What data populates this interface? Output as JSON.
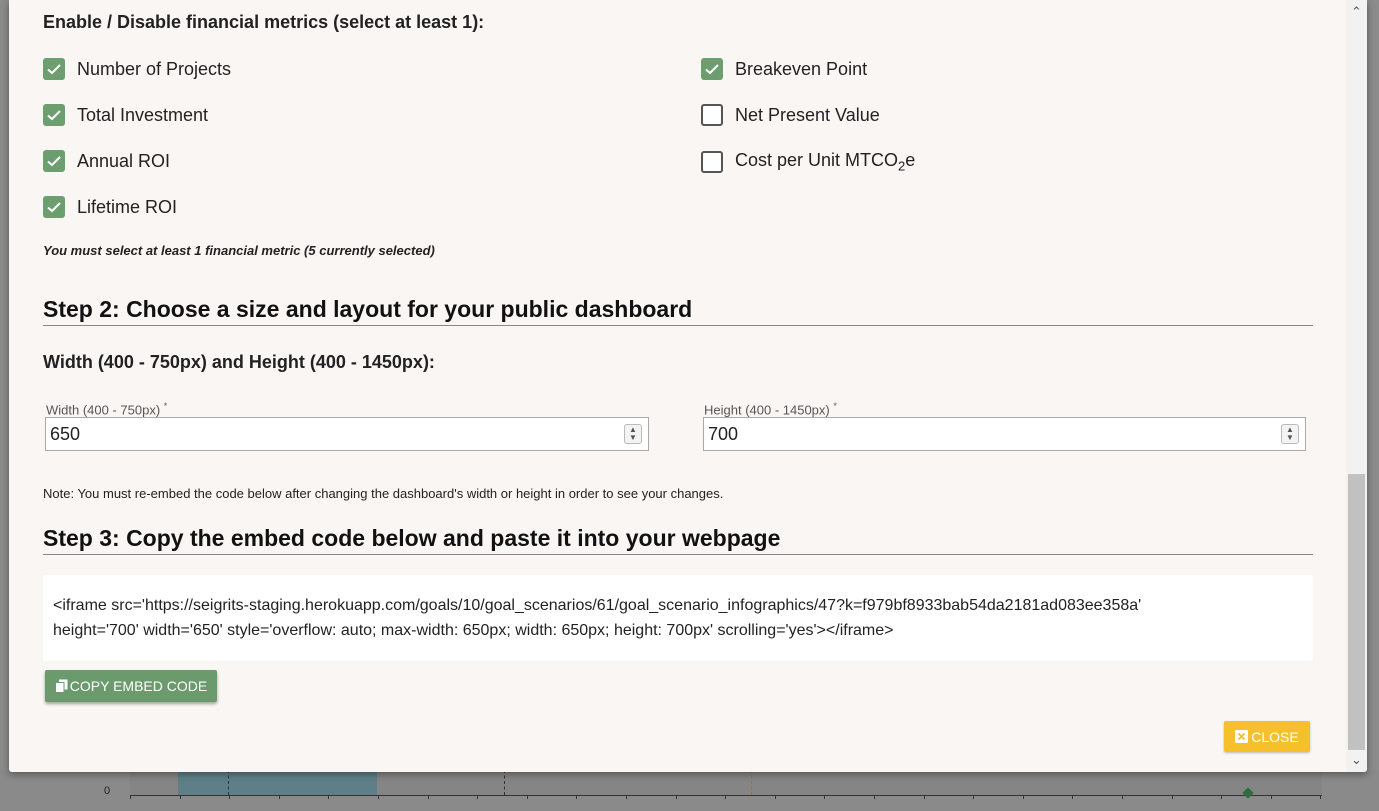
{
  "metrics": {
    "section_label": "Enable / Disable financial metrics (select at least 1):",
    "left": [
      {
        "label": "Number of Projects",
        "checked": true
      },
      {
        "label": "Total Investment",
        "checked": true
      },
      {
        "label": "Annual ROI",
        "checked": true
      },
      {
        "label": "Lifetime ROI",
        "checked": true
      }
    ],
    "right": [
      {
        "label": "Breakeven Point",
        "checked": true
      },
      {
        "label": "Net Present Value",
        "checked": false
      },
      {
        "label_prefix": "Cost per Unit MTCO",
        "label_sub": "2",
        "label_suffix": "e",
        "checked": false
      }
    ],
    "note": "You must select at least 1 financial metric (5 currently selected)"
  },
  "step2": {
    "heading": "Step 2: Choose a size and layout for your public dashboard",
    "subheading": "Width (400 - 750px) and Height (400 - 1450px):",
    "width_label": "Width (400 - 750px)",
    "width_value": "650",
    "height_label": "Height (400 - 1450px)",
    "height_value": "700",
    "required_mark": "*",
    "note": "Note: You must re-embed the code below after changing the dashboard's width or height in order to see your changes."
  },
  "step3": {
    "heading": "Step 3: Copy the embed code below and paste it into your webpage",
    "code_line1": "<iframe src='https://seigrits-staging.herokuapp.com/goals/10/goal_scenarios/61/goal_scenario_infographics/47?k=f979bf8933bab54da2181ad083ee358a'",
    "code_line2": "height='700' width='650' style='overflow: auto; max-width: 650px; width: 650px; height: 700px' scrolling='yes'></iframe>",
    "copy_label": "COPY EMBED CODE"
  },
  "close_label": "CLOSE",
  "background_chart": {
    "zero_label": "0"
  },
  "colors": {
    "accent_green": "#6d9e6f",
    "close_yellow": "#f5c02c"
  },
  "icons": {
    "copy": "copy-icon",
    "close": "close-square-icon",
    "check": "check-icon"
  }
}
